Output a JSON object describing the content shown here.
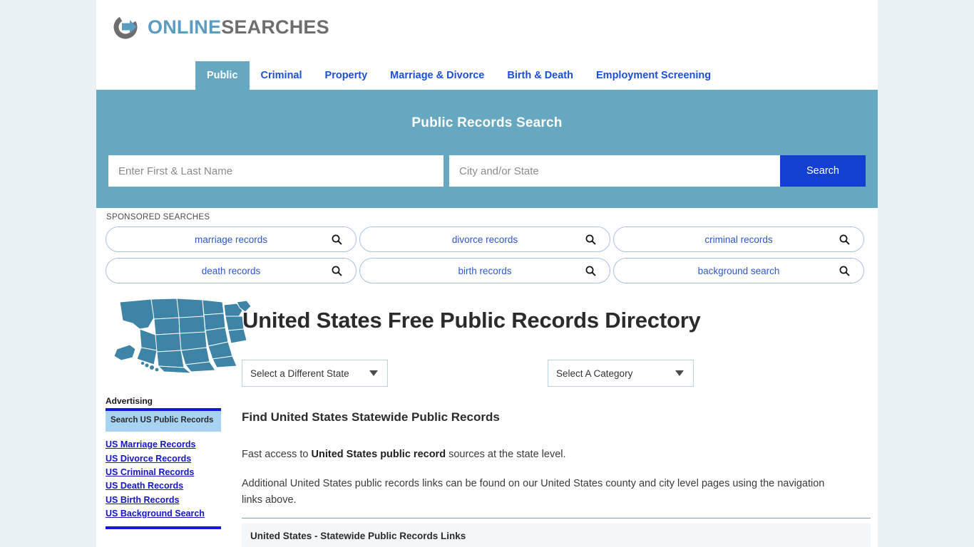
{
  "brand": {
    "logo_icon": "circular-arrow-icon",
    "name_primary": "ONLINE",
    "name_secondary": "SEARCHES"
  },
  "nav": {
    "tabs": [
      {
        "label": "Public",
        "active": true
      },
      {
        "label": "Criminal",
        "active": false
      },
      {
        "label": "Property",
        "active": false
      },
      {
        "label": "Marriage & Divorce",
        "active": false
      },
      {
        "label": "Birth & Death",
        "active": false
      },
      {
        "label": "Employment Screening",
        "active": false
      }
    ]
  },
  "search": {
    "title": "Public Records Search",
    "name_placeholder": "Enter First & Last Name",
    "name_value": "",
    "city_placeholder": "City and/or State",
    "city_value": "",
    "button_label": "Search"
  },
  "sponsored": {
    "label": "SPONSORED SEARCHES",
    "items": [
      {
        "label": "marriage records",
        "icon": "search-icon"
      },
      {
        "label": "divorce records",
        "icon": "search-icon"
      },
      {
        "label": "criminal records",
        "icon": "search-icon"
      },
      {
        "label": "death records",
        "icon": "search-icon"
      },
      {
        "label": "birth records",
        "icon": "search-icon"
      },
      {
        "label": "background search",
        "icon": "search-icon"
      }
    ]
  },
  "hero": {
    "map_icon": "united-states-map",
    "title": "United States Free Public Records Directory",
    "state_select": {
      "value": "Select a Different State",
      "arrow": "chevron-down-icon"
    },
    "category_select": {
      "value": "Select A Category",
      "arrow": "chevron-down-icon"
    }
  },
  "sidebar": {
    "heading": "Advertising",
    "ad_box_text": "Search US Public Records",
    "links": [
      "US Marriage Records",
      "US Divorce Records",
      "US Criminal Records",
      "US Death Records",
      "US Birth Records",
      "US Background Search"
    ]
  },
  "main": {
    "section_heading": "Find United States Statewide Public Records",
    "paragraph1_prefix": "Fast access to ",
    "paragraph1_bold": "United States public record",
    "paragraph1_suffix": " sources at the state level.",
    "paragraph2": "Additional United States public records links can be found on our United States county and city level pages using the navigation links above.",
    "panel_heading": "United States - Statewide Public Records Links"
  },
  "colors": {
    "page_bg": "#eaf1f5",
    "band_teal": "#66a7c1",
    "link_blue": "#1a4fd6",
    "button_blue": "#1340d0",
    "ad_blue": "#1515e0",
    "ad_box_bg": "#a6d3f2",
    "map_fill": "#3d84a6"
  }
}
